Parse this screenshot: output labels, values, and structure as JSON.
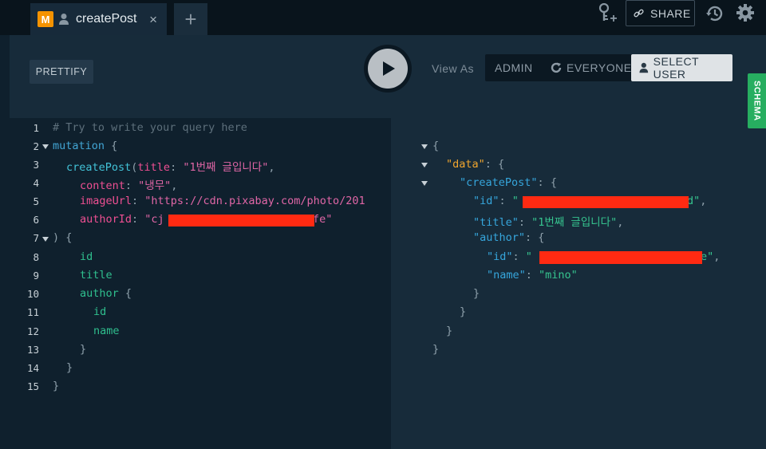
{
  "tab": {
    "badge": "M",
    "title": "createPost",
    "close": "×",
    "add": "+"
  },
  "toolbar": {
    "share_label": "SHARE"
  },
  "query_toolbar": {
    "prettify_label": "PRETTIFY"
  },
  "roles": {
    "view_as_label": "View As",
    "admin_label": "ADMIN",
    "everyone_label": "EVERYONE",
    "select_user_label": "SELECT USER",
    "selected": "SELECT USER"
  },
  "schema_label": "SCHEMA",
  "query": {
    "line_numbers": [
      "1",
      "2",
      "3",
      "4",
      "5",
      "6",
      "7",
      "8",
      "9",
      "10",
      "11",
      "12",
      "13",
      "14",
      "15"
    ],
    "comment": "# Try to write your query here",
    "keyword": "mutation",
    "open_brace": "{",
    "function_name": "createPost",
    "arg_title_key": "title",
    "arg_title_value": "\"1번째 글입니다\"",
    "arg_content_key": "content",
    "arg_content_value": "\"냉무\"",
    "arg_image_key": "imageUrl",
    "arg_image_value": "\"https://cdn.pixabay.com/photo/201",
    "arg_author_key": "authorId",
    "arg_author_value_start": "\"cj",
    "arg_author_value_end": "fe\"",
    "close_args": ") {",
    "field_id": "id",
    "field_title": "title",
    "field_author": "author",
    "sub_field_id": "id",
    "sub_field_name": "name",
    "close_brace": "}"
  },
  "result": {
    "data_key": "\"data\"",
    "create_post_key": "\"createPost\"",
    "id_key": "\"id\"",
    "id_value_start": "\"",
    "id_value_end": "d\"",
    "title_key": "\"title\"",
    "title_value": "\"1번째 글입니다\"",
    "author_key": "\"author\"",
    "author_id_key": "\"id\"",
    "author_id_value_start": "\"",
    "author_id_value_end": "e\"",
    "name_key": "\"name\"",
    "name_value": "\"mino\""
  },
  "colors": {
    "badge": "#f59300",
    "schema": "#27ae60",
    "redaction": "#ff2a12",
    "run_button": "#b9bfc4"
  }
}
